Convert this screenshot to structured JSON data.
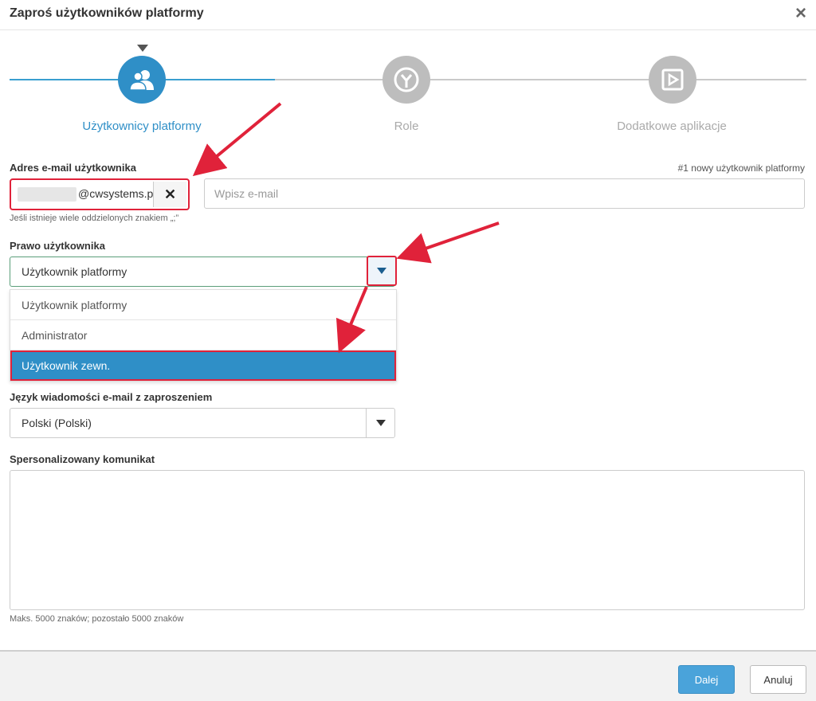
{
  "dialog": {
    "title": "Zaproś użytkowników platformy",
    "close_icon": "×"
  },
  "stepper": {
    "steps": [
      {
        "label": "Użytkownicy platformy",
        "icon": "users-icon",
        "state": "active"
      },
      {
        "label": "Role",
        "icon": "role-icon",
        "state": "inactive"
      },
      {
        "label": "Dodatkowe aplikacje",
        "icon": "apps-icon",
        "state": "inactive"
      }
    ]
  },
  "email": {
    "label": "Adres e-mail użytkownika",
    "counter": "#1 nowy użytkownik platformy",
    "tag_suffix": "@cwsystems.pl",
    "remove_symbol": "✕",
    "placeholder": "Wpisz e-mail",
    "hint": "Jeśli istnieje wiele oddzielonych znakiem „;”"
  },
  "rights": {
    "label": "Prawo użytkownika",
    "selected": "Użytkownik platformy",
    "options": [
      "Użytkownik platformy",
      "Administrator",
      "Użytkownik zewn."
    ],
    "highlighted_option": "Użytkownik zewn."
  },
  "language": {
    "label": "Język wiadomości e-mail z zaproszeniem",
    "selected": "Polski (Polski)"
  },
  "message": {
    "label": "Spersonalizowany komunikat",
    "hint": "Maks. 5000 znaków; pozostało 5000 znaków"
  },
  "footer": {
    "next_label": "Dalej",
    "cancel_label": "Anuluj"
  },
  "colors": {
    "accent": "#2f8fc7",
    "annotation": "#e0223a",
    "inactive_step": "#bdbdbd"
  }
}
